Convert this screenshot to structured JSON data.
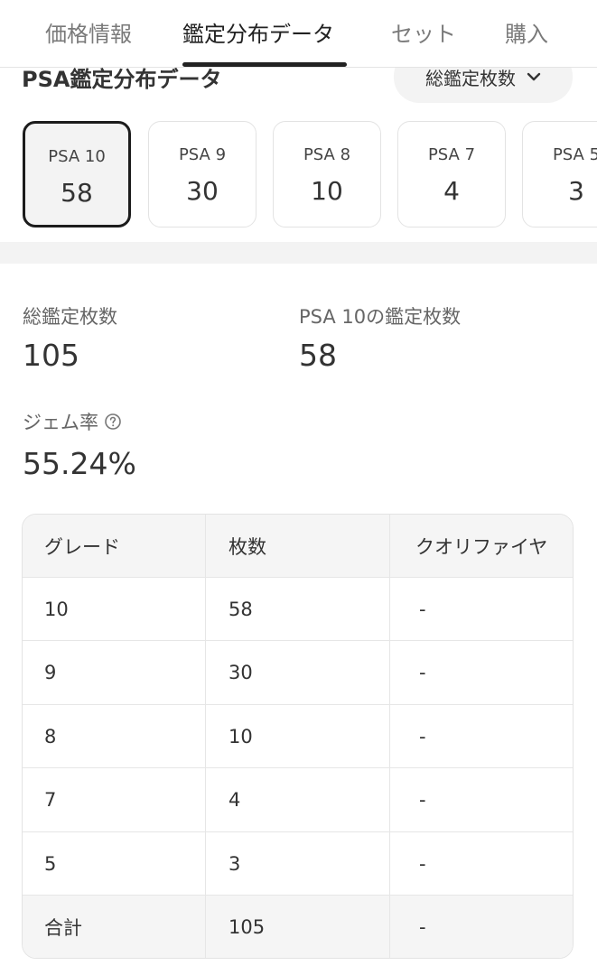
{
  "tabs": [
    {
      "label": "価格情報",
      "active": false
    },
    {
      "label": "鑑定分布データ",
      "active": true
    },
    {
      "label": "セット",
      "active": false
    },
    {
      "label": "購入",
      "active": false
    }
  ],
  "section": {
    "title": "PSA鑑定分布データ",
    "sort_label": "総鑑定枚数",
    "sort_icon": "chevron-down-icon"
  },
  "grade_cards": [
    {
      "label": "PSA 10",
      "count": "58",
      "selected": true
    },
    {
      "label": "PSA 9",
      "count": "30",
      "selected": false
    },
    {
      "label": "PSA 8",
      "count": "10",
      "selected": false
    },
    {
      "label": "PSA 7",
      "count": "4",
      "selected": false
    },
    {
      "label": "PSA 5",
      "count": "3",
      "selected": false
    }
  ],
  "stats": {
    "total_label": "総鑑定枚数",
    "total_value": "105",
    "selected_label": "PSA 10の鑑定枚数",
    "selected_value": "58",
    "gem_rate_label": "ジェム率",
    "gem_rate_value": "55.24%",
    "gem_rate_icon": "help-circle-icon"
  },
  "table": {
    "headers": [
      "グレード",
      "枚数",
      "クオリファイヤ"
    ],
    "rows": [
      [
        "10",
        "58",
        "-"
      ],
      [
        "9",
        "30",
        "-"
      ],
      [
        "8",
        "10",
        "-"
      ],
      [
        "7",
        "4",
        "-"
      ],
      [
        "5",
        "3",
        "-"
      ]
    ],
    "total": [
      "合計",
      "105",
      "-"
    ]
  },
  "colors": {
    "text": "#333333",
    "muted": "#7a7a7a",
    "selected_border": "#1c1c1c",
    "panel_bg": "#f3f3f3",
    "border": "#e3e3e3"
  }
}
